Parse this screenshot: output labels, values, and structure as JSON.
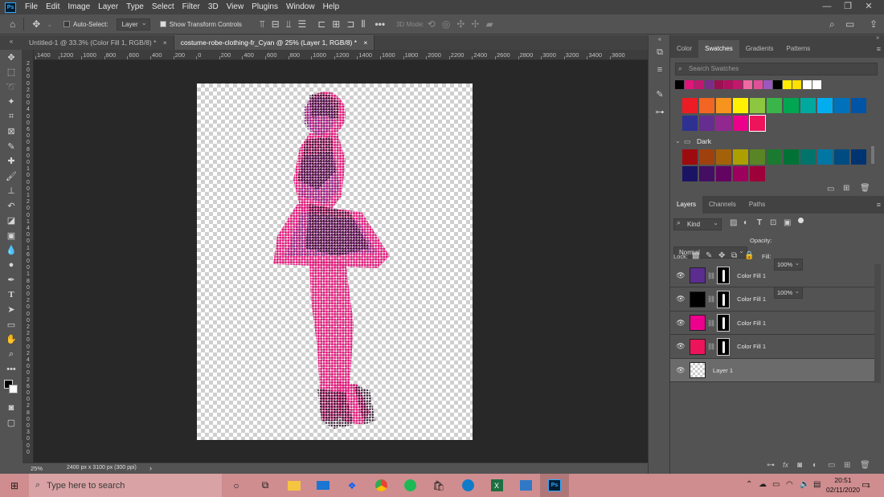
{
  "menubar": {
    "items": [
      "File",
      "Edit",
      "Image",
      "Layer",
      "Type",
      "Select",
      "Filter",
      "3D",
      "View",
      "Plugins",
      "Window",
      "Help"
    ],
    "window_controls": [
      "—",
      "❐",
      "✕"
    ]
  },
  "optionsbar": {
    "auto_select_label": "Auto-Select:",
    "auto_select_value": "Layer",
    "show_transform_label": "Show Transform Controls",
    "mode_3d_label": "3D Mode:",
    "more": "•••"
  },
  "doc_tabs": [
    {
      "label": "Untitled-1 @ 33.3% (Color Fill 1, RGB/8) *",
      "close": "×"
    },
    {
      "label": "costume-robe-clothing-fr_Cyan @ 25% (Layer 1, RGB/8) *",
      "close": "×"
    }
  ],
  "ruler": {
    "h_ticks": [
      "1400",
      "1200",
      "1000",
      "800",
      "600",
      "400",
      "200",
      "0",
      "200",
      "400",
      "600",
      "800",
      "1000",
      "1200",
      "1400",
      "1600",
      "1800",
      "2000",
      "2200",
      "2400",
      "2600",
      "2800",
      "3000",
      "3200",
      "3400",
      "3600"
    ],
    "v_ticks": [
      "2",
      "0",
      "0",
      "0",
      "2",
      "0",
      "0",
      "4",
      "0",
      "0",
      "6",
      "0",
      "0",
      "8",
      "0",
      "0",
      "1",
      "0",
      "0",
      "0",
      "1",
      "2",
      "0",
      "0",
      "1",
      "4",
      "0",
      "0",
      "1",
      "6",
      "0",
      "0",
      "1",
      "8",
      "0",
      "0",
      "2",
      "0",
      "0",
      "0",
      "2",
      "2",
      "0",
      "0",
      "2",
      "4",
      "0",
      "0",
      "2",
      "6",
      "0",
      "0",
      "2",
      "8",
      "0",
      "0",
      "3",
      "0",
      "0",
      "0"
    ]
  },
  "statusbar": {
    "zoom": "25%",
    "doc_info": "2400 px x 3100 px (300 ppi)",
    "arrow": "›"
  },
  "swatches_panel": {
    "tabs": [
      "Color",
      "Swatches",
      "Gradients",
      "Patterns"
    ],
    "active_tab": "Swatches",
    "search_placeholder": "Search Swatches",
    "recent": [
      "#000000",
      "#e0147a",
      "#c01870",
      "#7a2d8c",
      "#9a1050",
      "#b01060",
      "#c0186a",
      "#ee6aa0",
      "#e05098",
      "#9a58c0",
      "#000000",
      "#ffeb00",
      "#ffe000",
      "#ffffff",
      "#ffffff"
    ],
    "bright_row1": [
      "#ed1c24",
      "#f26522",
      "#f7941d",
      "#fff200",
      "#8dc63f",
      "#39b54a",
      "#00a651",
      "#00a99d",
      "#00aeef",
      "#0072bc",
      "#0054a6"
    ],
    "bright_row2": [
      "#2e3192",
      "#662d91",
      "#92278f",
      "#ec008c",
      "#ed145b"
    ],
    "group_name": "Dark",
    "dark_row1": [
      "#9e0b0f",
      "#a0410d",
      "#a36209",
      "#aba000",
      "#598527",
      "#1a7b30",
      "#007236",
      "#00746b",
      "#0076a3",
      "#004b80",
      "#003471"
    ],
    "dark_row2": [
      "#1b1464",
      "#440e62",
      "#630460",
      "#9e005d",
      "#9e0039"
    ]
  },
  "layers_panel": {
    "tabs": [
      "Layers",
      "Channels",
      "Paths"
    ],
    "active_tab": "Layers",
    "kind_label": "Kind",
    "blend_mode": "Normal",
    "opacity_label": "Opacity:",
    "opacity_value": "100%",
    "lock_label": "Lock:",
    "fill_label": "Fill:",
    "fill_value": "100%",
    "layers": [
      {
        "name": "Color Fill 1",
        "color": "#5b2d8e",
        "mask": true
      },
      {
        "name": "Color Fill 1",
        "color": "#000000",
        "mask": true
      },
      {
        "name": "Color Fill 1",
        "color": "#ec008c",
        "mask": true
      },
      {
        "name": "Color Fill 1",
        "color": "#ed145b",
        "mask": true
      },
      {
        "name": "Layer 1",
        "color": "transparent",
        "mask": false,
        "selected": true
      }
    ]
  },
  "taskbar": {
    "search_placeholder": "Type here to search",
    "time": "20:51",
    "date": "02/11/2020",
    "notification_count": "1"
  }
}
